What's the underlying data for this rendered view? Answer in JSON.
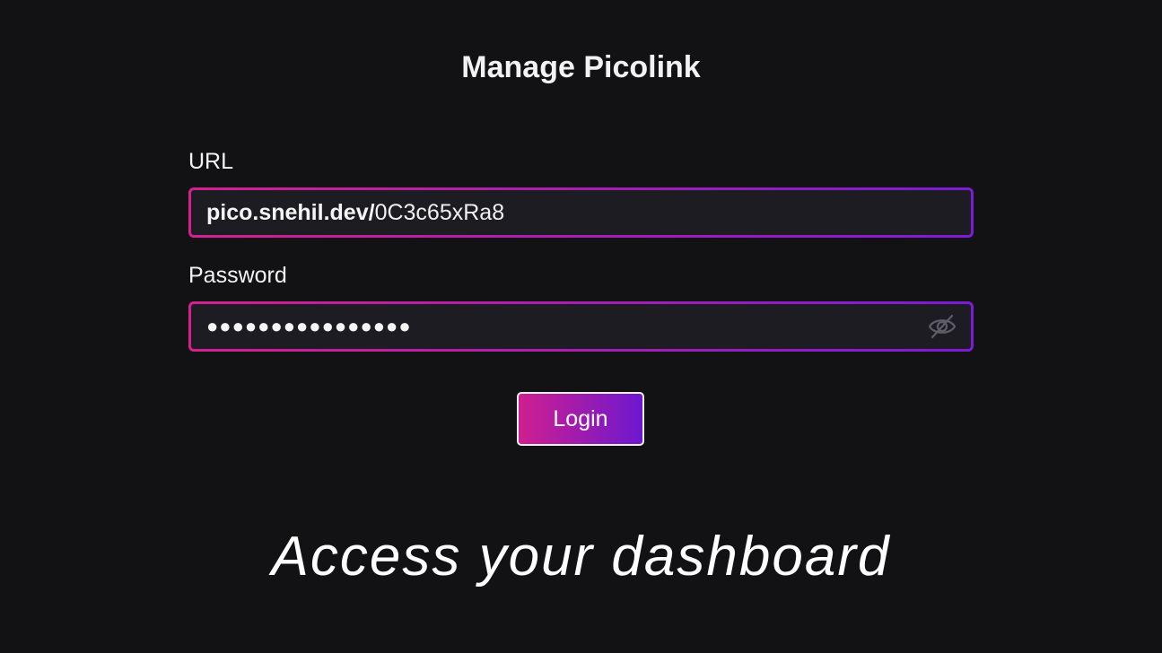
{
  "page": {
    "title": "Manage Picolink",
    "tagline": "Access your dashboard"
  },
  "form": {
    "url": {
      "label": "URL",
      "prefix": "pico.snehil.dev/",
      "slug": "0C3c65xRa8"
    },
    "password": {
      "label": "Password",
      "masked_value": "●●●●●●●●●●●●●●●●",
      "toggle_icon": "eye-slash-icon"
    },
    "login_label": "Login"
  },
  "colors": {
    "background": "#121114",
    "field_background": "#1d1c23",
    "gradient_start": "#d4218f",
    "gradient_end": "#7c1bd6"
  }
}
